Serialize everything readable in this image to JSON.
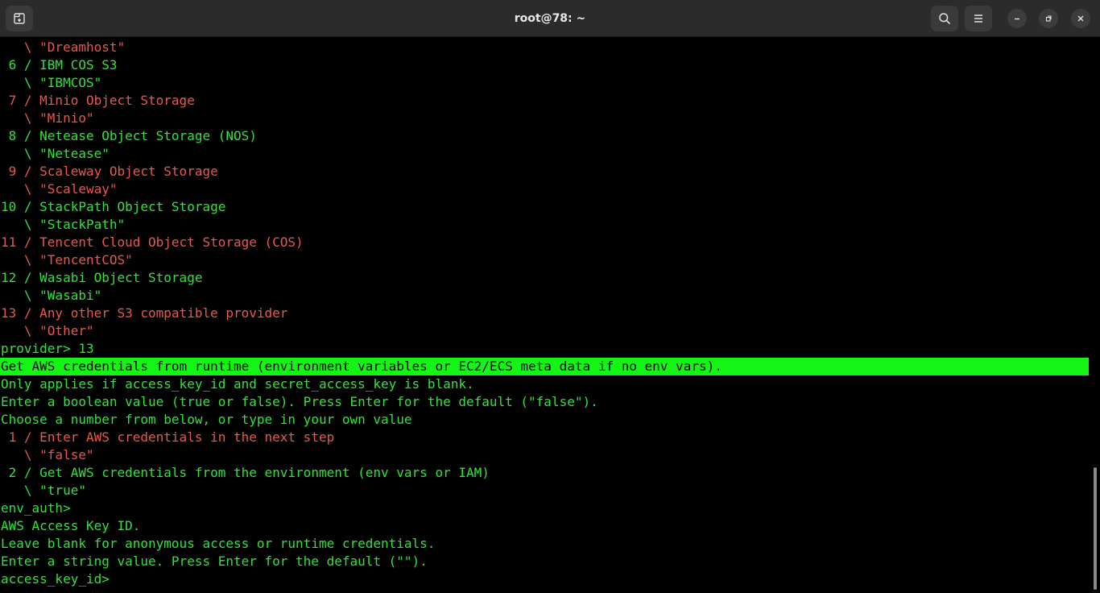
{
  "window": {
    "title": "root@78: ~"
  },
  "terminal": {
    "lines": [
      {
        "text": "   \\ \"Dreamhost\"",
        "color": "red"
      },
      {
        "text": " 6 / IBM COS S3",
        "color": "green"
      },
      {
        "text": "   \\ \"IBMCOS\"",
        "color": "green"
      },
      {
        "text": " 7 / Minio Object Storage",
        "color": "red"
      },
      {
        "text": "   \\ \"Minio\"",
        "color": "red"
      },
      {
        "text": " 8 / Netease Object Storage (NOS)",
        "color": "green"
      },
      {
        "text": "   \\ \"Netease\"",
        "color": "green"
      },
      {
        "text": " 9 / Scaleway Object Storage",
        "color": "red"
      },
      {
        "text": "   \\ \"Scaleway\"",
        "color": "red"
      },
      {
        "text": "10 / StackPath Object Storage",
        "color": "green"
      },
      {
        "text": "   \\ \"StackPath\"",
        "color": "green"
      },
      {
        "text": "11 / Tencent Cloud Object Storage (COS)",
        "color": "red"
      },
      {
        "text": "   \\ \"TencentCOS\"",
        "color": "red"
      },
      {
        "text": "12 / Wasabi Object Storage",
        "color": "green"
      },
      {
        "text": "   \\ \"Wasabi\"",
        "color": "green"
      },
      {
        "text": "13 / Any other S3 compatible provider",
        "color": "red"
      },
      {
        "text": "   \\ \"Other\"",
        "color": "red"
      },
      {
        "text": "provider> 13",
        "color": "green"
      },
      {
        "text": "Get AWS credentials from runtime (environment variables or EC2/ECS meta data if no env vars).",
        "color": "highlight"
      },
      {
        "text": "Only applies if access_key_id and secret_access_key is blank.",
        "color": "green"
      },
      {
        "text": "Enter a boolean value (true or false). Press Enter for the default (\"false\").",
        "color": "green"
      },
      {
        "text": "Choose a number from below, or type in your own value",
        "color": "green"
      },
      {
        "text": " 1 / Enter AWS credentials in the next step",
        "color": "red"
      },
      {
        "text": "   \\ \"false\"",
        "color": "red"
      },
      {
        "text": " 2 / Get AWS credentials from the environment (env vars or IAM)",
        "color": "green"
      },
      {
        "text": "   \\ \"true\"",
        "color": "green"
      },
      {
        "text": "env_auth>",
        "color": "green"
      },
      {
        "text": "AWS Access Key ID.",
        "color": "green"
      },
      {
        "text": "Leave blank for anonymous access or runtime credentials.",
        "color": "green"
      },
      {
        "text": "Enter a string value. Press Enter for the default (\"\").",
        "color": "green"
      },
      {
        "text": "access_key_id>",
        "color": "green"
      }
    ]
  },
  "colors": {
    "green": "#33e13a",
    "red": "#e8594a",
    "highlight_bg": "#15f515",
    "background": "#000000",
    "titlebar": "#2b2b2b"
  },
  "icons": {
    "new_tab": "new-tab-icon",
    "search": "search-icon",
    "menu": "hamburger-menu-icon",
    "minimize": "minimize-icon",
    "maximize": "restore-icon",
    "close": "close-icon"
  }
}
